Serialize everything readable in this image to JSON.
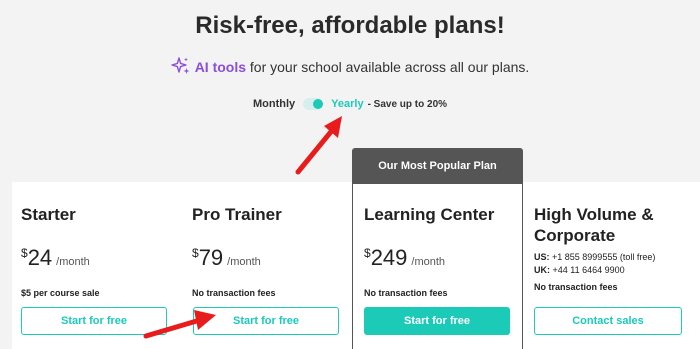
{
  "header": {
    "title": "Risk-free, affordable plans!",
    "ai_highlight": "AI tools",
    "subtitle_rest": "for your school available across all our plans."
  },
  "billing": {
    "monthly_label": "Monthly",
    "yearly_label": "Yearly",
    "save_label": "- Save up to 20%",
    "selected": "Yearly"
  },
  "popular_badge": "Our Most Popular Plan",
  "plans": [
    {
      "name": "Starter",
      "currency": "$",
      "price": "24",
      "period": "/month",
      "note": "$5 per course sale",
      "button": "Start for free"
    },
    {
      "name": "Pro Trainer",
      "currency": "$",
      "price": "79",
      "period": "/month",
      "note": "No transaction fees",
      "button": "Start for free"
    },
    {
      "name": "Learning Center",
      "currency": "$",
      "price": "249",
      "period": "/month",
      "note": "No transaction fees",
      "button": "Start for free"
    },
    {
      "name_line1": "High Volume &",
      "name_line2": "Corporate",
      "us_label": "US:",
      "us_phone": "+1 855 8999555 (toll free)",
      "uk_label": "UK:",
      "uk_phone": "+44 11 6464 9900",
      "note": "No transaction fees",
      "button": "Contact sales"
    }
  ],
  "colors": {
    "accent": "#1ccab8",
    "ai_purple": "#8a4fd8",
    "popular_dark": "#555555",
    "annotation_arrow": "#e81c1c"
  },
  "icons": {
    "sparkle": "sparkle-icon"
  }
}
